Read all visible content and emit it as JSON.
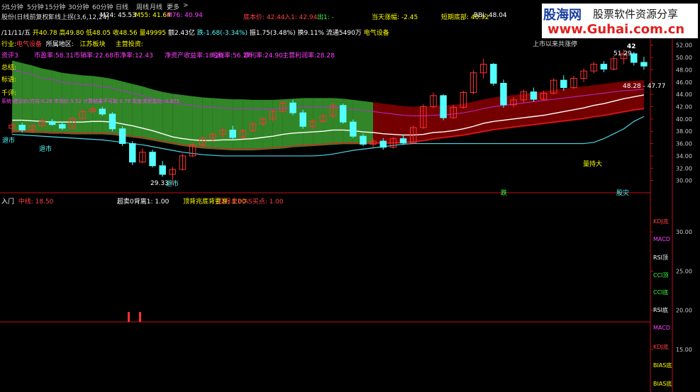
{
  "toolbar": {
    "period_tabs": [
      "分",
      "1分钟",
      "5分钟",
      "15分钟",
      "30分钟",
      "60分钟",
      "日线",
      "周线",
      "月线",
      "更多"
    ],
    "more_arrow": ">"
  },
  "header": {
    "stock_label": "股份(日线前复权)",
    "ma_label": "年线上拐(3,6,12,24)",
    "m24": "M24: 45.53",
    "m55": "M55: 41.64",
    "m76": "M76: 40.94",
    "bottom_price": "底本价: 42.44",
    "entry": "入1: 42.94",
    "exit": "出1: -",
    "change_today": "当天涨幅: -2.45",
    "short_line": "短期底部: 40.92",
    "bbi": "BBI: 48.04"
  },
  "info_bar": {
    "date": "/11/11/五",
    "open": "开40.78",
    "high": "高49.80",
    "low": "低48.05",
    "close": "收48.56",
    "volume": "量49995",
    "amount": "额2.43亿",
    "change": "跌-1.68(-3.34%)",
    "amplitude": "振1.75(3.48%)",
    "turnover": "换9.11%",
    "float": "流通5490万",
    "sector": "电气设备"
  },
  "detail_row": {
    "industry_label": "行业:",
    "industry_value": "电气设备",
    "region_label": "所属地区:",
    "region_value": "江苏板块",
    "business_label": "主营投资:",
    "ratios": [
      "市盈率:58.31",
      "市销率:22.68",
      "市净率:12.43",
      "净资产收益率:18.20",
      "毛利率:56.17",
      "净利率:24.90",
      "主营利润率:28.28"
    ],
    "left_labels": [
      "资评3",
      "总结:",
      "标语:",
      "千评:"
    ],
    "long_label": "系统-建议价/方向:0.28 市场价:5.52 计算结果不可取 0.79 现金流状态比:-0.875"
  },
  "chart_annotations": {
    "listing_note": "上市以来共涨停",
    "rise_count": "42",
    "high_label": "51.29",
    "price_box": "48.28 - 47.77",
    "low_label": "29.33",
    "sell_labels": [
      "退市",
      "退市",
      "退市"
    ],
    "bottom_mark": "跌",
    "peak_mark": "股灾",
    "strong_mark": "量持大",
    "right_mark": "42"
  },
  "sub_header": {
    "title": "入门",
    "mid_line": "中线: 18.50",
    "oversold": "超卖0背离1: 1.00",
    "volume_bottom": "顶背兆底背要准: 1.00",
    "red_bias": "红月虎BIAS买点: 1.00"
  },
  "sub_right_labels": [
    "KDJ底",
    "MACD",
    "RSI顶",
    "CCI顶",
    "CCI底",
    "RSI底",
    "MACD",
    "KDJ底",
    "BIAS底",
    "BIAS底"
  ],
  "logo": {
    "brand_cn": "股海网",
    "slogan": "股票软件资源分享",
    "url": "www.Guhai.com.cn"
  },
  "colors": {
    "up": "#ff3232",
    "down": "#54ffff",
    "yellow": "#ffff00",
    "magenta": "#ff00ff",
    "green_cloud": "#3a9d2e",
    "red_cloud": "#8a0000",
    "white_line": "#ffffff",
    "cyan_line": "#4ad7e8",
    "red_line": "#e02020",
    "purple_line": "#b030d0",
    "axis_red": "#c01010"
  },
  "chart_data": [
    {
      "type": "candlestick",
      "title": "",
      "ylim": [
        28,
        53
      ],
      "y_ticks": [
        30.0,
        32.0,
        34.0,
        36.0,
        38.0,
        40.0,
        42.0,
        44.0,
        46.0,
        48.0,
        50.0,
        52.0
      ],
      "candles": [
        [
          38.5,
          39.6,
          37.6,
          39.0
        ],
        [
          39.0,
          39.4,
          37.8,
          38.2
        ],
        [
          38.2,
          39.2,
          37.8,
          38.9
        ],
        [
          38.9,
          40.2,
          38.6,
          39.6
        ],
        [
          39.6,
          40.0,
          38.9,
          39.1
        ],
        [
          39.1,
          39.6,
          38.2,
          38.5
        ],
        [
          38.5,
          40.4,
          38.4,
          40.1
        ],
        [
          40.1,
          41.5,
          39.9,
          41.2
        ],
        [
          41.2,
          42.1,
          40.9,
          41.6
        ],
        [
          41.6,
          42.0,
          40.5,
          40.8
        ],
        [
          40.8,
          41.1,
          38.0,
          38.4
        ],
        [
          38.4,
          38.8,
          35.6,
          36.0
        ],
        [
          36.0,
          36.4,
          32.5,
          33.0
        ],
        [
          33.0,
          35.2,
          32.8,
          34.6
        ],
        [
          34.6,
          35.0,
          32.1,
          32.4
        ],
        [
          32.4,
          33.2,
          30.6,
          31.0
        ],
        [
          31.0,
          32.2,
          29.3,
          31.8
        ],
        [
          31.8,
          34.3,
          31.6,
          34.0
        ],
        [
          34.0,
          36.1,
          33.8,
          35.8
        ],
        [
          35.8,
          37.2,
          35.5,
          36.9
        ],
        [
          36.9,
          37.8,
          36.3,
          37.5
        ],
        [
          37.5,
          38.5,
          37.0,
          38.2
        ],
        [
          38.2,
          38.9,
          36.5,
          37.0
        ],
        [
          37.0,
          38.4,
          36.8,
          38.1
        ],
        [
          38.1,
          39.5,
          37.9,
          39.2
        ],
        [
          39.2,
          40.3,
          38.8,
          40.0
        ],
        [
          40.0,
          41.6,
          39.6,
          41.2
        ],
        [
          41.2,
          43.0,
          41.0,
          42.6
        ],
        [
          42.6,
          43.1,
          40.6,
          41.0
        ],
        [
          41.0,
          41.5,
          38.4,
          38.8
        ],
        [
          38.8,
          40.0,
          38.2,
          39.6
        ],
        [
          39.6,
          40.8,
          39.3,
          40.5
        ],
        [
          40.5,
          42.6,
          40.1,
          42.2
        ],
        [
          42.2,
          42.5,
          39.2,
          39.5
        ],
        [
          39.5,
          39.9,
          36.9,
          37.2
        ],
        [
          37.2,
          37.6,
          35.6,
          35.9
        ],
        [
          35.9,
          36.8,
          35.4,
          36.4
        ],
        [
          36.4,
          36.9,
          35.0,
          35.4
        ],
        [
          35.4,
          37.1,
          35.2,
          36.8
        ],
        [
          36.8,
          37.5,
          35.8,
          36.1
        ],
        [
          36.1,
          38.9,
          36.0,
          38.6
        ],
        [
          38.6,
          42.4,
          38.4,
          42.0
        ],
        [
          42.0,
          44.3,
          41.8,
          43.8
        ],
        [
          43.8,
          44.0,
          39.8,
          40.2
        ],
        [
          40.2,
          42.3,
          40.0,
          41.9
        ],
        [
          41.9,
          44.6,
          41.7,
          44.3
        ],
        [
          44.3,
          47.9,
          44.0,
          47.5
        ],
        [
          47.5,
          49.8,
          46.6,
          48.9
        ],
        [
          48.9,
          49.1,
          45.4,
          45.8
        ],
        [
          45.8,
          46.4,
          41.8,
          42.3
        ],
        [
          42.3,
          43.6,
          41.9,
          43.1
        ],
        [
          43.1,
          44.8,
          42.6,
          44.4
        ],
        [
          44.4,
          45.1,
          42.8,
          43.2
        ],
        [
          43.2,
          44.6,
          43.0,
          44.2
        ],
        [
          44.2,
          46.6,
          44.0,
          46.3
        ],
        [
          46.3,
          47.1,
          44.6,
          45.1
        ],
        [
          45.1,
          47.0,
          44.9,
          46.6
        ],
        [
          46.6,
          48.2,
          46.0,
          47.8
        ],
        [
          47.8,
          49.3,
          47.4,
          48.9
        ],
        [
          48.9,
          49.4,
          47.6,
          48.1
        ],
        [
          48.1,
          50.2,
          47.9,
          49.8
        ],
        [
          49.8,
          51.3,
          48.9,
          50.6
        ],
        [
          50.6,
          50.9,
          48.7,
          49.2
        ],
        [
          49.2,
          50.1,
          48.0,
          48.6
        ]
      ],
      "series": [
        {
          "name": "M24",
          "values": [
            39.8,
            39.8,
            39.7,
            39.6,
            39.5,
            39.5,
            39.5,
            39.5,
            39.6,
            39.6,
            39.5,
            39.2,
            38.9,
            38.5,
            38.1,
            37.6,
            37.1,
            36.8,
            36.6,
            36.5,
            36.5,
            36.6,
            36.6,
            36.7,
            36.8,
            37.0,
            37.2,
            37.5,
            37.7,
            37.8,
            37.9,
            38.0,
            38.2,
            38.2,
            38.1,
            37.9,
            37.8,
            37.6,
            37.5,
            37.4,
            37.4,
            37.5,
            37.8,
            37.9,
            38.1,
            38.4,
            38.8,
            39.3,
            39.6,
            39.8,
            40.0,
            40.2,
            40.4,
            40.6,
            40.9,
            41.2,
            41.5,
            41.8,
            42.2,
            42.5,
            42.9,
            43.3,
            43.6,
            43.9
          ]
        },
        {
          "name": "M55",
          "values": [
            38.0,
            38.0,
            37.9,
            37.9,
            37.8,
            37.8,
            37.7,
            37.7,
            37.7,
            37.7,
            37.6,
            37.4,
            37.2,
            37.0,
            36.7,
            36.4,
            36.1,
            35.8,
            35.6,
            35.4,
            35.3,
            35.2,
            35.1,
            35.1,
            35.1,
            35.2,
            35.3,
            35.4,
            35.6,
            35.7,
            35.8,
            35.9,
            36.0,
            36.1,
            36.1,
            36.1,
            36.1,
            36.1,
            36.1,
            36.2,
            36.3,
            36.5,
            36.8,
            37.0,
            37.2,
            37.4,
            37.7,
            38.0,
            38.3,
            38.5,
            38.7,
            38.9,
            39.1,
            39.3,
            39.5,
            39.7,
            39.9,
            40.1,
            40.4,
            40.6,
            40.9,
            41.2,
            41.5,
            41.7
          ]
        },
        {
          "name": "M76",
          "values": [
            37.5,
            37.4,
            37.3,
            37.2,
            37.1,
            37.0,
            36.9,
            36.8,
            36.7,
            36.6,
            36.4,
            36.2,
            36.0,
            35.8,
            35.5,
            35.2,
            34.9,
            34.6,
            34.4,
            34.2,
            34.1,
            34.0,
            34.0,
            34.0,
            34.0,
            34.0,
            34.0,
            34.0,
            34.0,
            34.0,
            34.0,
            34.1,
            34.3,
            34.6,
            34.9,
            35.1,
            35.3,
            35.5,
            35.7,
            35.9,
            36.0,
            36.0,
            36.0,
            36.0,
            36.0,
            36.0,
            36.0,
            36.0,
            36.0,
            36.0,
            36.0,
            36.0,
            36.0,
            36.0,
            36.0,
            36.0,
            36.0,
            36.0,
            36.2,
            36.8,
            37.6,
            38.4,
            39.6,
            40.4
          ]
        },
        {
          "name": "BBI",
          "values": [
            48.0,
            47.6,
            47.2,
            46.7,
            46.4,
            46.0,
            45.8,
            45.6,
            45.5,
            45.3,
            45.0,
            44.6,
            44.2,
            43.8,
            43.3,
            42.9,
            42.6,
            42.4,
            42.2,
            42.0,
            41.9,
            41.8,
            41.7,
            41.7,
            41.6,
            41.6,
            41.6,
            41.7,
            41.8,
            41.9,
            41.9,
            41.9,
            41.9,
            41.8,
            41.6,
            41.4,
            41.2,
            41.0,
            40.8,
            40.6,
            40.5,
            40.5,
            40.6,
            40.7,
            40.8,
            41.0,
            41.3,
            41.7,
            42.0,
            42.2,
            42.4,
            42.6,
            42.8,
            43.0,
            43.2,
            43.4,
            43.6,
            43.8,
            44.0,
            44.2,
            44.4,
            44.6,
            44.7,
            44.8
          ]
        }
      ]
    },
    {
      "type": "line",
      "title": "",
      "ylim": [
        10,
        35
      ],
      "y_ticks": [
        15.0,
        20.0,
        25.0,
        30.0
      ],
      "series": [
        {
          "name": "中线",
          "values": [
            18.5
          ]
        }
      ]
    }
  ]
}
